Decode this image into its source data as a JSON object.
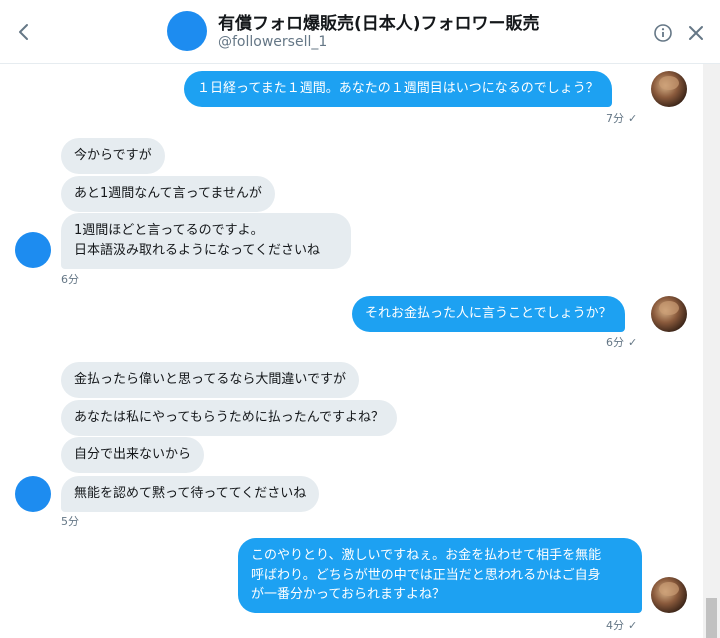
{
  "header": {
    "title": "有償フォロ爆販売(日本人)フォロワー販売",
    "handle": "@followersell_1"
  },
  "messages": {
    "m1": {
      "text": "１日経ってまた１週間。あなたの１週間目はいつになるのでしょう？",
      "time": "7分"
    },
    "m2": {
      "text": "今からですが"
    },
    "m3": {
      "text": "あと1週間なんて言ってませんが"
    },
    "m4": {
      "line1": "1週間ほどと言ってるのですよ。",
      "line2": "日本語汲み取れるようになってくださいね",
      "time": "6分"
    },
    "m5": {
      "text": "それお金払った人に言うことでしょうか？",
      "time": "6分"
    },
    "m6": {
      "text": "金払ったら偉いと思ってるなら大間違いですが"
    },
    "m7": {
      "text": "あなたは私にやってもらうために払ったんですよね？"
    },
    "m8": {
      "text": "自分で出来ないから"
    },
    "m9": {
      "text": "無能を認めて黙って待っててくださいね",
      "time": "5分"
    },
    "m10": {
      "line1": "このやりとり、激しいですねぇ。お金を払わせて相手を無能",
      "line2": "呼ばわり。どちらが世の中では正当だと思われるかはご自身",
      "line3": "が一番分かっておられますよね？",
      "time": "4分"
    }
  },
  "icons": {
    "back": "chevron-left-icon",
    "info": "info-icon",
    "close": "close-icon",
    "read": "checkmark-icon"
  },
  "colors": {
    "outgoing_bubble": "#1da1f2",
    "incoming_bubble": "#e6ecf0",
    "muted_text": "#657786"
  }
}
